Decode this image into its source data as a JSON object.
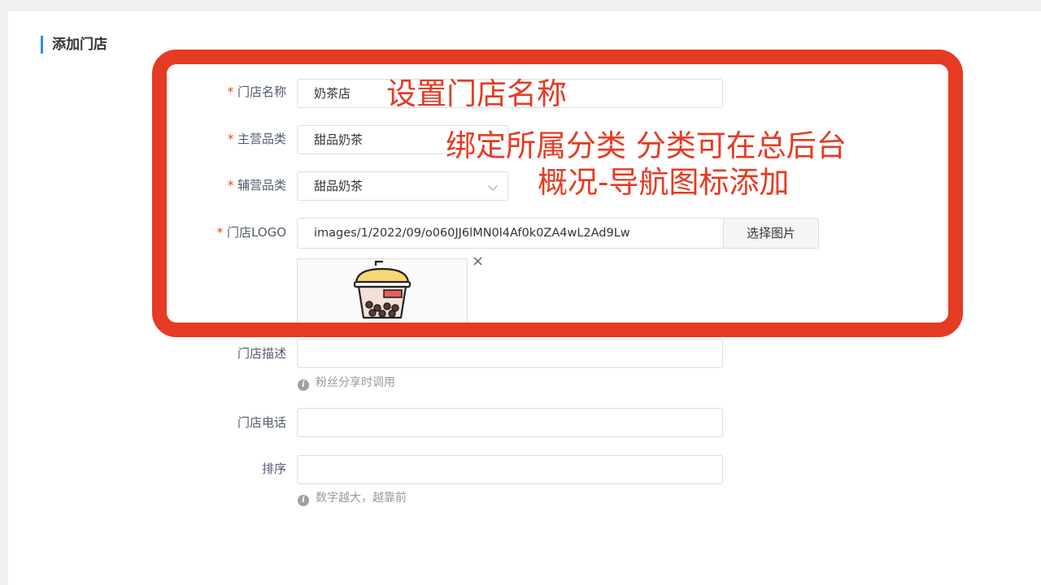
{
  "page": {
    "title": "添加门店"
  },
  "form": {
    "store_name": {
      "label": "门店名称",
      "value": "奶茶店"
    },
    "main_category": {
      "label": "主营品类",
      "value": "甜品奶茶"
    },
    "sub_category": {
      "label": "辅营品类",
      "value": "甜品奶茶"
    },
    "logo": {
      "label": "门店LOGO",
      "path": "images/1/2022/09/o060JJ6lMN0l4Af0k0ZA4wL2Ad9Lw",
      "button": "选择图片",
      "remove_icon": "×"
    },
    "description": {
      "label": "门店描述",
      "value": "",
      "tip": "粉丝分享时调用"
    },
    "phone": {
      "label": "门店电话",
      "value": ""
    },
    "sort": {
      "label": "排序",
      "value": "",
      "tip": "数字越大，越靠前"
    },
    "required_mark": "*",
    "info_icon": "i"
  },
  "annotations": {
    "store_name": "设置门店名称",
    "category_line1": "绑定所属分类 分类可在总后台",
    "category_line2": "概况-导航图标添加"
  },
  "colors": {
    "accent": "#2d8cf0",
    "annotation": "#e53b22",
    "required": "#ed4014"
  }
}
